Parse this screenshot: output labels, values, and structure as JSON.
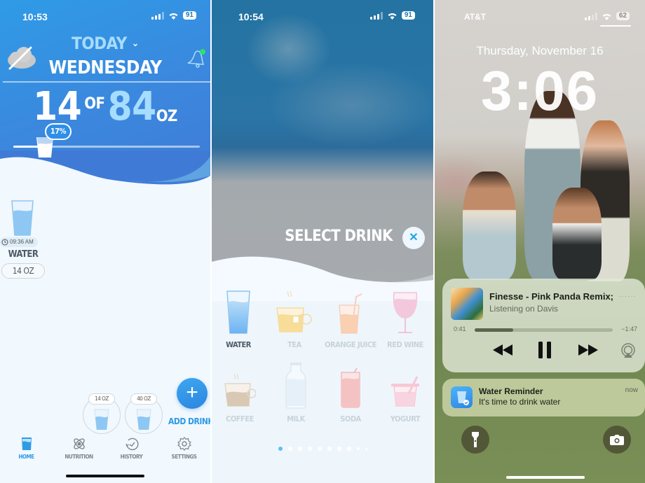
{
  "screen1": {
    "status": {
      "time": "10:53",
      "battery": "91"
    },
    "header": {
      "period": "TODAY",
      "weekday": "WEDNESDAY"
    },
    "intake": {
      "consumed": "14",
      "of_label": "OF",
      "goal": "84",
      "unit": "OZ",
      "percent_label": "17%",
      "progress_fraction": 0.17
    },
    "log": [
      {
        "time": "09:36 AM",
        "drink": "WATER",
        "amount": "14 OZ"
      }
    ],
    "quick_add": [
      {
        "label": "14 OZ"
      },
      {
        "label": "40 OZ"
      }
    ],
    "add_drink_label": "ADD DRINK",
    "tabs": [
      {
        "label": "HOME",
        "icon": "glass-icon",
        "active": true
      },
      {
        "label": "NUTRITION",
        "icon": "atom-icon",
        "active": false
      },
      {
        "label": "HISTORY",
        "icon": "history-icon",
        "active": false
      },
      {
        "label": "SETTINGS",
        "icon": "gear-icon",
        "active": false
      }
    ],
    "colors": {
      "accent": "#2f9be6",
      "header_top": "#2f9be6",
      "header_bottom": "#3f7bd6"
    }
  },
  "screen2": {
    "status": {
      "time": "10:54",
      "battery": "91"
    },
    "title": "SELECT DRINK",
    "close_icon": "close-icon",
    "drinks": [
      {
        "name": "WATER",
        "selected": true
      },
      {
        "name": "TEA",
        "selected": false
      },
      {
        "name": "ORANGE JUICE",
        "selected": false
      },
      {
        "name": "RED WINE",
        "selected": false
      },
      {
        "name": "COFFEE",
        "selected": false
      },
      {
        "name": "MILK",
        "selected": false
      },
      {
        "name": "SODA",
        "selected": false
      },
      {
        "name": "YOGURT",
        "selected": false
      }
    ],
    "pager": {
      "pages": 10,
      "current": 1
    }
  },
  "screen3": {
    "status": {
      "carrier": "AT&T",
      "battery": "62"
    },
    "date": "Thursday, November 16",
    "time": "3:06",
    "now_playing": {
      "title": "Finesse - Pink Panda Remix;",
      "device": "Listening on Davis",
      "elapsed": "0:41",
      "remaining": "−1:47",
      "progress_fraction": 0.28
    },
    "notification": {
      "app": "Water Reminder",
      "body": "It's time to drink water",
      "time": "now"
    }
  }
}
